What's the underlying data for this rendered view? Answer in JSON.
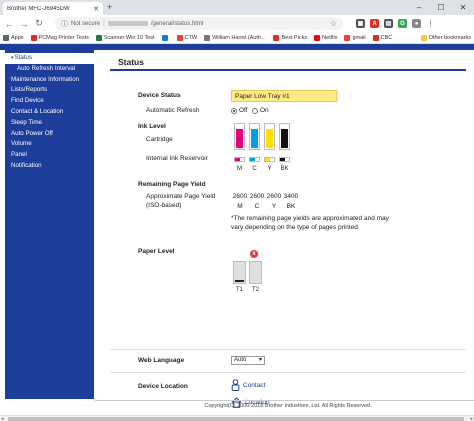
{
  "browser": {
    "tab_title": "Brother MFC-J6945DW",
    "address_security": "Not secure",
    "address_path": "/general/status.html",
    "bookmarks": [
      {
        "label": "Apps",
        "color": "#5f6368"
      },
      {
        "label": "PCMag Printer Tests",
        "color": "#d93025"
      },
      {
        "label": "Scanner Win 10 Test",
        "color": "#188038"
      },
      {
        "label": "",
        "color": "#1a73e8"
      },
      {
        "label": "CTW",
        "color": "#ea4335"
      },
      {
        "label": "William Harrel (Auth…",
        "color": "#777777"
      },
      {
        "label": "Best Picks",
        "color": "#d93025"
      },
      {
        "label": "Netflix",
        "color": "#e50914"
      },
      {
        "label": "gmail",
        "color": "#ea4335"
      },
      {
        "label": "CBC",
        "color": "#d93025"
      }
    ],
    "other_bookmarks": "Other bookmarks"
  },
  "sidebar": {
    "items": [
      {
        "label": "Status",
        "active": true,
        "sub": false
      },
      {
        "label": "Auto Refresh Interval",
        "active": false,
        "sub": true
      },
      {
        "label": "Maintenance Information",
        "active": false,
        "sub": false
      },
      {
        "label": "Lists/Reports",
        "active": false,
        "sub": false
      },
      {
        "label": "Find Device",
        "active": false,
        "sub": false
      },
      {
        "label": "Contact & Location",
        "active": false,
        "sub": false
      },
      {
        "label": "Sleep Time",
        "active": false,
        "sub": false
      },
      {
        "label": "Auto Power Off",
        "active": false,
        "sub": false
      },
      {
        "label": "Volume",
        "active": false,
        "sub": false
      },
      {
        "label": "Panel",
        "active": false,
        "sub": false
      },
      {
        "label": "Notification",
        "active": false,
        "sub": false
      }
    ]
  },
  "main": {
    "title": "Status",
    "device_status": {
      "label": "Device Status",
      "value": "Paper Low Tray #1"
    },
    "auto_refresh": {
      "label": "Automatic Refresh",
      "off": "Off",
      "on": "On",
      "selected": "Off"
    },
    "ink_level": {
      "label": "Ink Level",
      "cartridge_label": "Cartridge",
      "internal_label": "Internal Ink Reservoir",
      "inks": [
        {
          "letter": "M",
          "color": "#e6007e",
          "level": 0.85,
          "internal": 0.55
        },
        {
          "letter": "C",
          "color": "#00a0e9",
          "level": 0.85,
          "internal": 0.55
        },
        {
          "letter": "Y",
          "color": "#ffe100",
          "level": 0.85,
          "internal": 0.55
        },
        {
          "letter": "BK",
          "color": "#111111",
          "level": 0.85,
          "internal": 0.55
        }
      ]
    },
    "page_yield": {
      "label": "Remaining Page Yield",
      "approx_label": "Approximate Page Yield",
      "iso_label": "(ISO-based)",
      "values": [
        "2600",
        "2600",
        "2600",
        "3400"
      ],
      "letters": [
        "M",
        "C",
        "Y",
        "BK"
      ],
      "note": "*The remaining page yields are approximated and may vary depending on the type of pages printed."
    },
    "paper_level": {
      "label": "Paper Level",
      "trays": [
        {
          "name": "T1",
          "level": 0.1
        },
        {
          "name": "T2",
          "level": 0.0
        }
      ],
      "error_mark": "x"
    },
    "web_language": {
      "label": "Web Language",
      "value": "Auto"
    },
    "device_location": {
      "label": "Device Location",
      "contact": "Contact",
      "location": "Location"
    }
  },
  "footer": {
    "copyright": "Copyright(C) 2000-2018 Brother Industries, Ltd. All Rights Reserved."
  }
}
